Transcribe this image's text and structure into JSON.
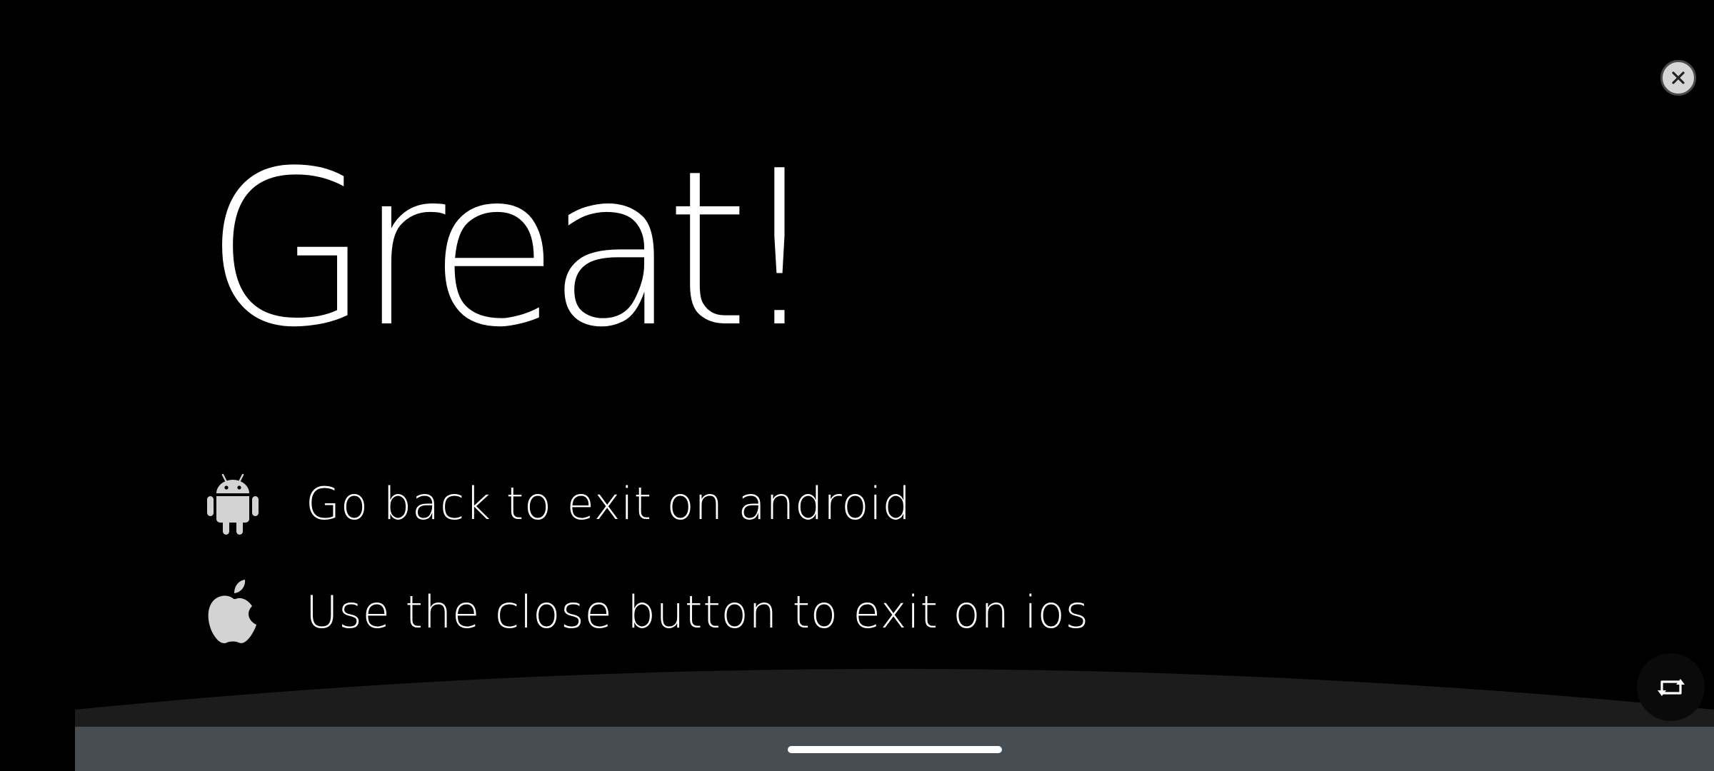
{
  "headline": "Great!",
  "instructions": [
    {
      "icon": "android-icon",
      "text": "Go back to exit on android"
    },
    {
      "icon": "apple-icon",
      "text": "Use the close button to exit on ios"
    }
  ],
  "controls": {
    "close_icon": "close-icon",
    "rotate_icon": "screen-rotate-icon"
  },
  "colors": {
    "background": "#000000",
    "text": "#ffffff",
    "icon_gray": "#d3d3d3",
    "bottom_bar": "#474e53",
    "curve": "#1c1c1c"
  }
}
